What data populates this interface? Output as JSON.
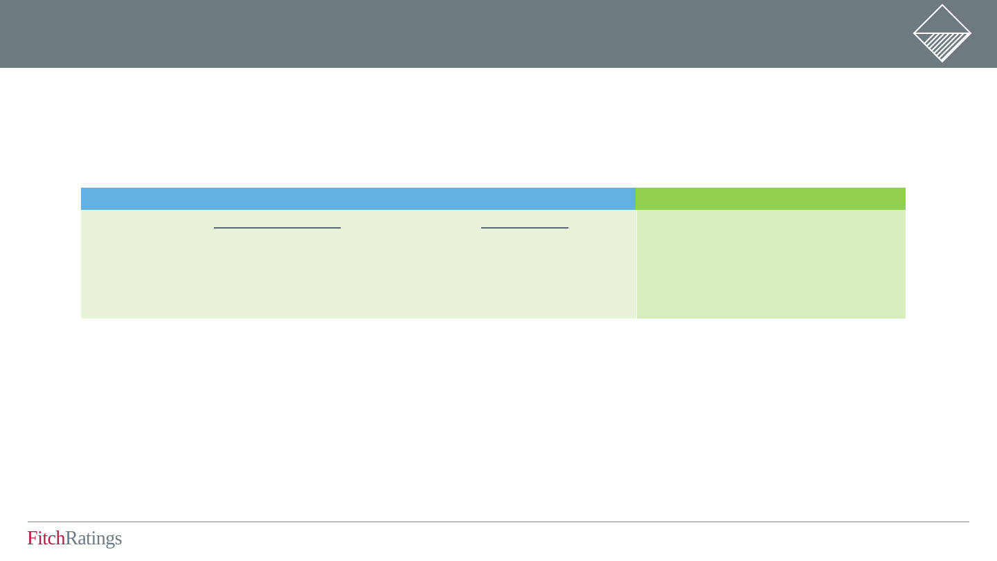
{
  "footer": {
    "brand_part1": "Fitch",
    "brand_part2": "Ratings"
  },
  "colors": {
    "header_band": "#6e7980",
    "table_header_blue": "#63b0e4",
    "table_header_green": "#92d050",
    "table_body_left": "#e8f3da",
    "table_body_right": "#d6eebe",
    "brand_fitch": "#b31b42",
    "brand_ratings": "#6b7a85"
  },
  "icons": {
    "corner": "diamond-hatched-logo-icon"
  }
}
